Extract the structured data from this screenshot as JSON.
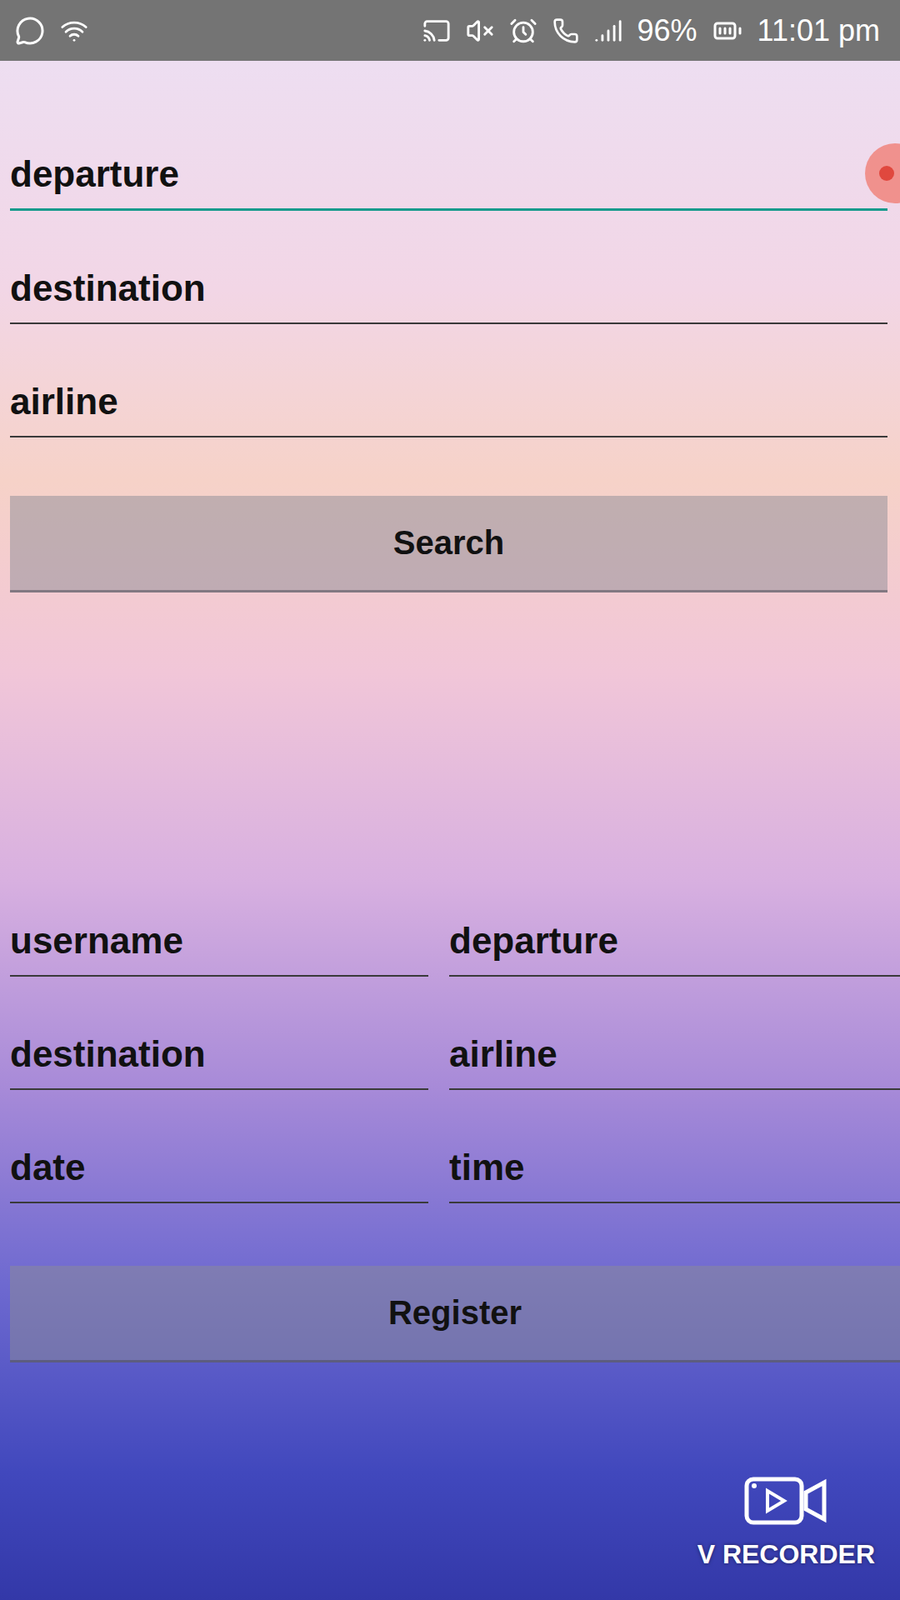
{
  "status_bar": {
    "battery": "96%",
    "time": "11:01 pm"
  },
  "search_form": {
    "fields": [
      {
        "placeholder": "departure",
        "focused": true
      },
      {
        "placeholder": "destination",
        "focused": false
      },
      {
        "placeholder": "airline",
        "focused": false
      }
    ],
    "button": "Search"
  },
  "register_form": {
    "fields": [
      {
        "placeholder": "username"
      },
      {
        "placeholder": "departure"
      },
      {
        "placeholder": "destination"
      },
      {
        "placeholder": "airline"
      },
      {
        "placeholder": "date"
      },
      {
        "placeholder": "time"
      }
    ],
    "button": "Register"
  },
  "watermark": {
    "label": "V RECORDER"
  }
}
